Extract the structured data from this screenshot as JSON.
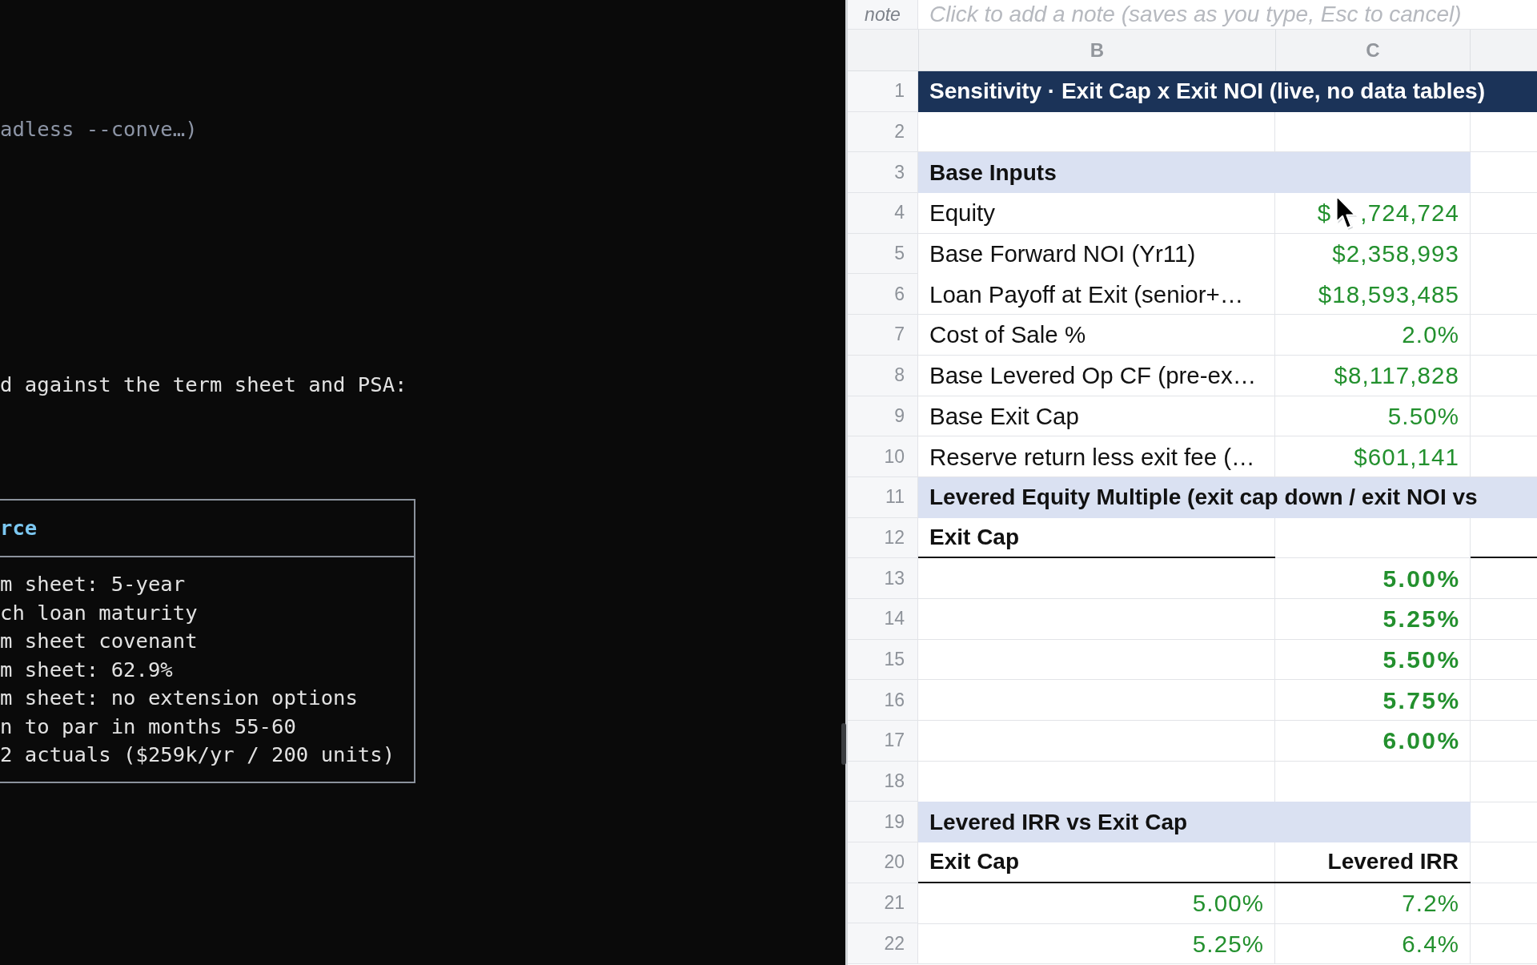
{
  "terminal": {
    "lines": [
      {
        "kind": "command",
        "text": "adless --conve…)"
      },
      {
        "kind": "output",
        "text": "d against the term sheet and PSA:"
      }
    ],
    "table": {
      "header": "rce",
      "rows": [
        "m sheet: 5-year",
        "ch loan maturity",
        "m sheet covenant",
        "m sheet: 62.9%",
        "m sheet: no extension options",
        "n to par in months 55-60",
        "2 actuals ($259k/yr / 200 units)"
      ]
    }
  },
  "spreadsheet": {
    "note": {
      "label": "note",
      "placeholder": "Click to add a note (saves as you type, Esc to cancel)"
    },
    "columns": [
      "B",
      "C"
    ],
    "rows": [
      {
        "number": "1",
        "kind": "title",
        "text": "Sensitivity · Exit Cap x Exit NOI (live, no data tables)"
      },
      {
        "number": "2",
        "kind": "blank"
      },
      {
        "number": "3",
        "kind": "section",
        "text": "Base Inputs"
      },
      {
        "number": "4",
        "kind": "input",
        "label": "Equity",
        "value": "$",
        "pointer": true,
        "value_after_pointer": ",724,724"
      },
      {
        "number": "5",
        "kind": "input",
        "label": "Base Forward NOI (Yr11)",
        "value": "$2,358,993"
      },
      {
        "number": "6",
        "kind": "input",
        "label": "Loan Payoff at Exit (senior+…",
        "value": "$18,593,485"
      },
      {
        "number": "7",
        "kind": "input",
        "label": "Cost of Sale %",
        "value": "2.0%"
      },
      {
        "number": "8",
        "kind": "input",
        "label": "Base Levered Op CF (pre-ex…",
        "value": "$8,117,828"
      },
      {
        "number": "9",
        "kind": "input",
        "label": "Base Exit Cap",
        "value": "5.50%"
      },
      {
        "number": "10",
        "kind": "input",
        "label": "Reserve return less exit fee (…",
        "value": "$601,141"
      },
      {
        "number": "11",
        "kind": "wide_section",
        "text": "Levered Equity Multiple (exit cap down / exit NOI vs"
      },
      {
        "number": "12",
        "kind": "header",
        "label": "Exit Cap",
        "underlined_cells": [
          true,
          false,
          true
        ]
      },
      {
        "number": "13",
        "kind": "axis",
        "value": "5.00%"
      },
      {
        "number": "14",
        "kind": "axis",
        "value": "5.25%"
      },
      {
        "number": "15",
        "kind": "axis",
        "value": "5.50%"
      },
      {
        "number": "16",
        "kind": "axis",
        "value": "5.75%"
      },
      {
        "number": "17",
        "kind": "axis",
        "value": "6.00%"
      },
      {
        "number": "18",
        "kind": "blank"
      },
      {
        "number": "19",
        "kind": "section",
        "text": "Levered IRR vs Exit Cap"
      },
      {
        "number": "20",
        "kind": "header",
        "label": "Exit Cap",
        "value": "Levered IRR",
        "underlined_cells": [
          true,
          true,
          false
        ]
      },
      {
        "number": "21",
        "kind": "pair",
        "label": "5.00%",
        "value": "7.2%"
      },
      {
        "number": "22",
        "kind": "pair",
        "label": "5.25%",
        "value": "6.4%"
      }
    ]
  }
}
